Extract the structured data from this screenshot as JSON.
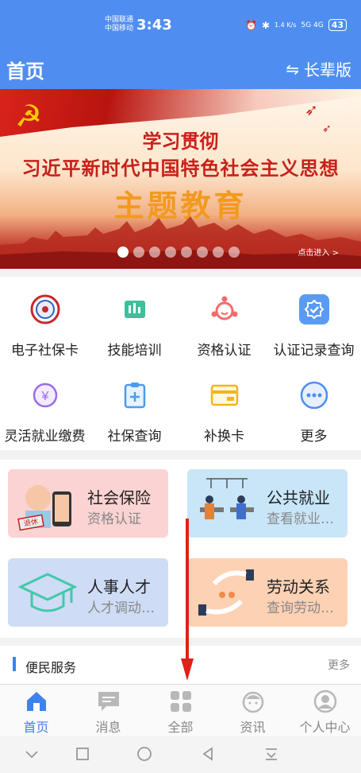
{
  "status": {
    "carrier1": "中国联通",
    "carrier2": "中国移动",
    "time": "3:43",
    "speed": "1.4 K/s",
    "network": "5G 4G",
    "battery": "43"
  },
  "header": {
    "title": "首页",
    "switch_label": "长辈版",
    "switch_icon": "swap-icon"
  },
  "banner": {
    "line1": "学习贯彻",
    "line2": "习近平新时代中国特色社会主义思想",
    "line3": "主题教育",
    "enter": "点击进入 >",
    "dot_count": 8,
    "active_dot": 0
  },
  "grid": [
    {
      "label": "电子社保卡",
      "icon": "social-card-icon"
    },
    {
      "label": "技能培训",
      "icon": "training-icon"
    },
    {
      "label": "资格认证",
      "icon": "certification-icon"
    },
    {
      "label": "认证记录查询",
      "icon": "record-query-icon"
    },
    {
      "label": "灵活就业缴费",
      "icon": "yuan-icon"
    },
    {
      "label": "社保查询",
      "icon": "clipboard-icon"
    },
    {
      "label": "补换卡",
      "icon": "card-icon"
    },
    {
      "label": "更多",
      "icon": "more-icon"
    }
  ],
  "cards": [
    {
      "title": "社会保险",
      "subtitle": "资格认证",
      "color": "#fbd3d3",
      "tag": "退休"
    },
    {
      "title": "公共就业",
      "subtitle": "查看就业…",
      "color": "#c9e6f8"
    },
    {
      "title": "人事人才",
      "subtitle": "人才调动…",
      "color": "#cfdcf6"
    },
    {
      "title": "劳动关系",
      "subtitle": "查询劳动…",
      "color": "#fdd1b4"
    }
  ],
  "service": {
    "title": "便民服务",
    "more": "更多"
  },
  "tabs": [
    {
      "label": "首页",
      "icon": "home-icon"
    },
    {
      "label": "消息",
      "icon": "message-icon"
    },
    {
      "label": "全部",
      "icon": "grid-icon"
    },
    {
      "label": "资讯",
      "icon": "news-icon"
    },
    {
      "label": "个人中心",
      "icon": "profile-icon"
    }
  ],
  "colors": {
    "primary": "#4f8ef0",
    "active_tab": "#3e82ee",
    "arrow": "#e0201a"
  }
}
